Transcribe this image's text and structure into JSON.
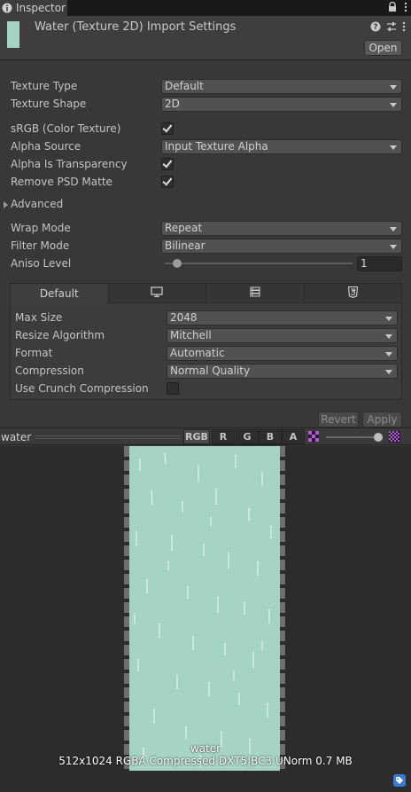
{
  "tab": {
    "label": "Inspector"
  },
  "header": {
    "title": "Water (Texture 2D) Import Settings",
    "open_label": "Open"
  },
  "properties": {
    "texture_type": {
      "label": "Texture Type",
      "value": "Default"
    },
    "texture_shape": {
      "label": "Texture Shape",
      "value": "2D"
    },
    "srgb": {
      "label": "sRGB (Color Texture)",
      "checked": true
    },
    "alpha_source": {
      "label": "Alpha Source",
      "value": "Input Texture Alpha"
    },
    "alpha_is_transparency": {
      "label": "Alpha Is Transparency",
      "checked": true
    },
    "remove_psd_matte": {
      "label": "Remove PSD Matte",
      "checked": true
    },
    "advanced": {
      "label": "Advanced"
    },
    "wrap_mode": {
      "label": "Wrap Mode",
      "value": "Repeat"
    },
    "filter_mode": {
      "label": "Filter Mode",
      "value": "Bilinear"
    },
    "aniso_level": {
      "label": "Aniso Level",
      "value": "1"
    }
  },
  "platform": {
    "tabs": [
      "Default",
      "monitor-icon",
      "server-icon",
      "html5-icon"
    ],
    "max_size": {
      "label": "Max Size",
      "value": "2048"
    },
    "resize_algorithm": {
      "label": "Resize Algorithm",
      "value": "Mitchell"
    },
    "format": {
      "label": "Format",
      "value": "Automatic"
    },
    "compression": {
      "label": "Compression",
      "value": "Normal Quality"
    },
    "crunch": {
      "label": "Use Crunch Compression",
      "checked": false
    }
  },
  "actions": {
    "revert": "Revert",
    "apply": "Apply"
  },
  "preview": {
    "name": "water",
    "channels": [
      "RGB",
      "R",
      "G",
      "B",
      "A"
    ],
    "texture_label": "water",
    "info": "512x1024  RGBA Compressed DXT5|BC3 UNorm   0.7 MB"
  },
  "colors": {
    "texture": "#a6d4c2",
    "panel": "#383838"
  }
}
